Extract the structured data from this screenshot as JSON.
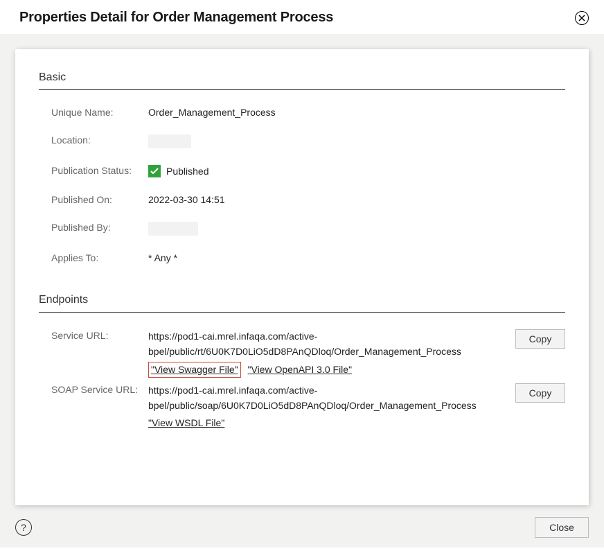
{
  "header": {
    "title": "Properties Detail for Order Management Process"
  },
  "basic": {
    "section_title": "Basic",
    "unique_name_label": "Unique Name:",
    "unique_name_value": "Order_Management_Process",
    "location_label": "Location:",
    "publication_status_label": "Publication Status:",
    "publication_status_value": "Published",
    "published_on_label": "Published On:",
    "published_on_value": "2022-03-30 14:51",
    "published_by_label": "Published By:",
    "applies_to_label": "Applies To:",
    "applies_to_value": "* Any *"
  },
  "endpoints": {
    "section_title": "Endpoints",
    "service_url_label": "Service URL:",
    "service_url_value": "https://pod1-cai.mrel.infaqa.com/active-bpel/public/rt/6U0K7D0LiO5dD8PAnQDloq/Order_Management_Process",
    "view_swagger_label": "\"View Swagger File\"",
    "view_openapi_label": "\"View OpenAPI 3.0 File\"",
    "soap_service_url_label": "SOAP Service URL:",
    "soap_service_url_value": "https://pod1-cai.mrel.infaqa.com/active-bpel/public/soap/6U0K7D0LiO5dD8PAnQDloq/Order_Management_Process",
    "view_wsdl_label": "\"View WSDL File\"",
    "copy_label": "Copy"
  },
  "footer": {
    "close_label": "Close"
  }
}
